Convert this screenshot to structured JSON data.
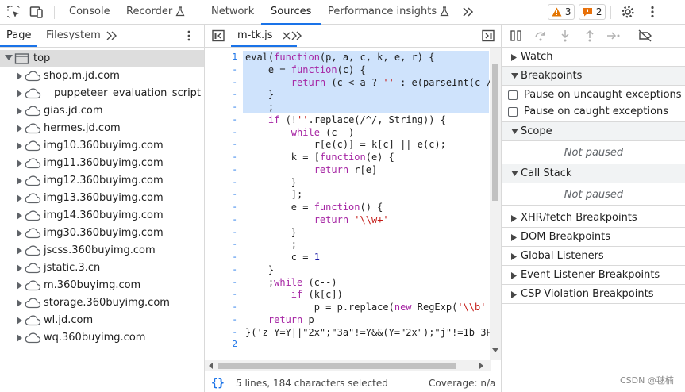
{
  "toolbar": {
    "tabs": [
      "Console",
      "Recorder",
      "Network",
      "Sources",
      "Performance insights"
    ],
    "active_tab": "Sources",
    "warnings_count": "3",
    "issues_count": "2"
  },
  "navigator": {
    "tabs": [
      "Page",
      "Filesystem"
    ],
    "active_tab": "Page",
    "tree": [
      {
        "label": "top",
        "expanded": true,
        "selected": true
      },
      {
        "label": "shop.m.jd.com"
      },
      {
        "label": "__puppeteer_evaluation_script__"
      },
      {
        "label": "gias.jd.com"
      },
      {
        "label": "hermes.jd.com"
      },
      {
        "label": "img10.360buyimg.com"
      },
      {
        "label": "img11.360buyimg.com"
      },
      {
        "label": "img12.360buyimg.com"
      },
      {
        "label": "img13.360buyimg.com"
      },
      {
        "label": "img14.360buyimg.com"
      },
      {
        "label": "img30.360buyimg.com"
      },
      {
        "label": "jscss.360buyimg.com"
      },
      {
        "label": "jstatic.3.cn"
      },
      {
        "label": "m.360buyimg.com"
      },
      {
        "label": "storage.360buyimg.com"
      },
      {
        "label": "wl.jd.com"
      },
      {
        "label": "wq.360buyimg.com"
      }
    ]
  },
  "editor": {
    "file_tab": "m-tk.js",
    "lines": [
      {
        "n": "1",
        "text": "eval(function(p, a, c, k, e, r) {",
        "hl": true
      },
      {
        "n": "-",
        "text": "    e = function(c) {",
        "hl": true
      },
      {
        "n": "-",
        "text": "        return (c < a ? '' : e(parseInt(c /",
        "hl": true
      },
      {
        "n": "-",
        "text": "    }",
        "hl": true
      },
      {
        "n": "-",
        "text": "    ;",
        "hl": true
      },
      {
        "n": "-",
        "text": "    if (!''.replace(/^/, String)) {",
        "hl": false
      },
      {
        "n": "-",
        "text": "        while (c--)",
        "hl": false
      },
      {
        "n": "-",
        "text": "            r[e(c)] = k[c] || e(c);",
        "hl": false
      },
      {
        "n": "-",
        "text": "        k = [function(e) {",
        "hl": false
      },
      {
        "n": "-",
        "text": "            return r[e]",
        "hl": false
      },
      {
        "n": "-",
        "text": "        }",
        "hl": false
      },
      {
        "n": "-",
        "text": "        ];",
        "hl": false
      },
      {
        "n": "-",
        "text": "        e = function() {",
        "hl": false
      },
      {
        "n": "-",
        "text": "            return '\\\\w+'",
        "hl": false
      },
      {
        "n": "-",
        "text": "        }",
        "hl": false
      },
      {
        "n": "-",
        "text": "        ;",
        "hl": false
      },
      {
        "n": "-",
        "text": "        c = 1",
        "hl": false
      },
      {
        "n": "-",
        "text": "    }",
        "hl": false
      },
      {
        "n": "-",
        "text": "    ;while (c--)",
        "hl": false
      },
      {
        "n": "-",
        "text": "        if (k[c])",
        "hl": false
      },
      {
        "n": "-",
        "text": "            p = p.replace(new RegExp('\\\\b'",
        "hl": false
      },
      {
        "n": "-",
        "text": "    return p",
        "hl": false
      },
      {
        "n": "-",
        "text": "}('z Y=Y||\"2x\";\"3a\"!=Y&&(Y=\"2x\");\"j\"!=1b 3P",
        "hl": false
      },
      {
        "n": "2",
        "text": "",
        "hl": false
      }
    ],
    "status_text": "5 lines, 184 characters selected",
    "coverage": "Coverage: n/a"
  },
  "debugger": {
    "sections": {
      "watch": "Watch",
      "breakpoints": "Breakpoints",
      "pause_uncaught": "Pause on uncaught exceptions",
      "pause_caught": "Pause on caught exceptions",
      "scope": "Scope",
      "scope_state": "Not paused",
      "call_stack": "Call Stack",
      "call_stack_state": "Not paused",
      "xhr": "XHR/fetch Breakpoints",
      "dom": "DOM Breakpoints",
      "global": "Global Listeners",
      "event": "Event Listener Breakpoints",
      "csp": "CSP Violation Breakpoints"
    }
  },
  "watermark": "CSDN @毬楠",
  "colors": {
    "accent": "#1a73e8",
    "selection": "#cfe3fc",
    "warning": "#e37400",
    "issue": "#e8710a"
  }
}
